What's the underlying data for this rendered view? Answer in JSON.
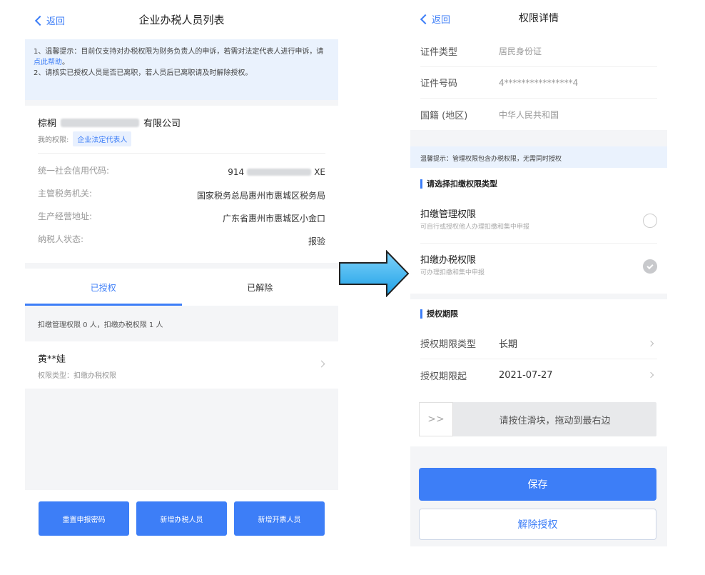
{
  "left": {
    "nav": {
      "back_label": "返回",
      "title": "企业办税人员列表"
    },
    "notice": {
      "line1_prefix": "1、温馨提示：目前仅支持对办税权限为财务负责人的申诉，若需对法定代表人进行申诉，请",
      "line1_link": "点此帮助",
      "line1_suffix": "。",
      "line2": "2、请核实已授权人员是否已离职，若人员后已离职请及时解除授权。"
    },
    "company": {
      "name_prefix": "棕桐",
      "name_suffix": "有限公司",
      "perm_label": "我的权限:",
      "perm_tag": "企业法定代表人",
      "rows": [
        {
          "k": "统一社会信用代码:",
          "v_prefix": "914",
          "v_suffix": "XE"
        },
        {
          "k": "主管税务机关:",
          "v": "国家税务总局惠州市惠城区税务局"
        },
        {
          "k": "生产经营地址:",
          "v": "广东省惠州市惠城区小金口"
        },
        {
          "k": "纳税人状态:",
          "v": "报验"
        }
      ]
    },
    "tabs": [
      {
        "label": "已授权"
      },
      {
        "label": "已解除"
      }
    ],
    "summary": "扣缴管理权限 0 人，扣缴办税权限 1 人",
    "person": {
      "name": "黄**娃",
      "type": "权限类型：扣缴办税权限"
    },
    "buttons": [
      {
        "label": "重置申报密码"
      },
      {
        "label": "新增办税人员"
      },
      {
        "label": "新增开票人员"
      }
    ]
  },
  "right": {
    "nav": {
      "back_label": "返回",
      "title": "权限详情"
    },
    "id_rows": [
      {
        "k": "证件类型",
        "v": "居民身份证"
      },
      {
        "k": "证件号码",
        "v": "4****************4"
      },
      {
        "k": "国籍 (地区)",
        "v": "中华人民共和国"
      }
    ],
    "tip": "温馨提示：管理权限包含办税权限，无需同时授权",
    "perm_section": {
      "heading": "请选择扣缴权限类型",
      "options": [
        {
          "title": "扣缴管理权限",
          "sub": "可自行或授权他人办理扣缴和集中申报",
          "checked": false
        },
        {
          "title": "扣缴办税权限",
          "sub": "可办理扣缴和集中申报",
          "checked": true
        }
      ]
    },
    "term_section": {
      "heading": "授权期限",
      "rows": [
        {
          "k": "授权期限类型",
          "v": "长期"
        },
        {
          "k": "授权期限起",
          "v": "2021-07-27"
        }
      ]
    },
    "slider": {
      "handle": ">>",
      "text": "请按住滑块，拖动到最右边"
    },
    "save_label": "保存",
    "revoke_label": "解除授权"
  },
  "colors": {
    "accent": "#3d7ef7",
    "arrow": "#29b6f6"
  }
}
